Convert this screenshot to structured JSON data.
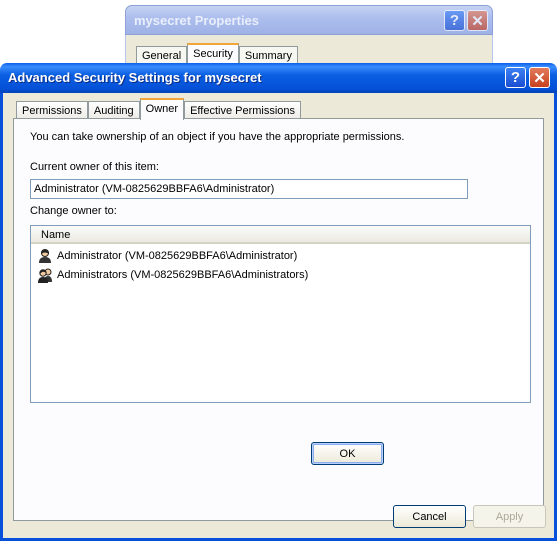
{
  "background_window": {
    "title": "mysecret Properties",
    "tabs": [
      "General",
      "Security",
      "Summary"
    ]
  },
  "dialog": {
    "title": "Advanced Security Settings for mysecret",
    "help_glyph": "?",
    "close_glyph": "✕",
    "tabs": [
      "Permissions",
      "Auditing",
      "Owner",
      "Effective Permissions"
    ],
    "active_tab": "Owner",
    "intro": "You can take ownership of an object if you have the appropriate permissions.",
    "current_owner_label": "Current owner of this item:",
    "current_owner_value": "Administrator (VM-0825629BBFA6\\Administrator)",
    "change_owner_label": "Change owner to:",
    "list_header": "Name",
    "owners": [
      {
        "name": "Administrator (VM-0825629BBFA6\\Administrator)",
        "icon": "user-icon"
      },
      {
        "name": "Administrators (VM-0825629BBFA6\\Administrators)",
        "icon": "group-icon"
      }
    ],
    "buttons": {
      "ok": "OK",
      "cancel": "Cancel",
      "apply": "Apply"
    }
  },
  "colors": {
    "title_bar": "#0a5fe1",
    "dialog_bg": "#ece9d8",
    "active_tab_accent": "#f2a63a",
    "field_border": "#7f9db9"
  }
}
